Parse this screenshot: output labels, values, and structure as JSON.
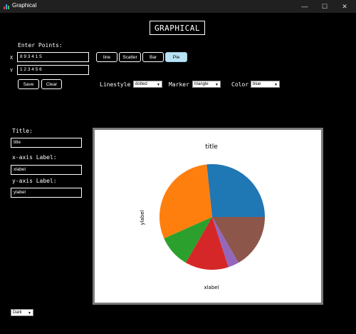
{
  "window": {
    "title": "Graphical",
    "minimize": "—",
    "maximize": "☐",
    "close": "✕"
  },
  "banner": "GRAPHICAL",
  "points": {
    "heading": "Enter Points:",
    "x_label": "X",
    "x_value": "8 9 3 4 1 5",
    "y_label": "Y",
    "y_value": "1 2 3 4 5 6"
  },
  "plot_types": [
    {
      "label": "line",
      "active": false
    },
    {
      "label": "Scatter",
      "active": false
    },
    {
      "label": "Bar",
      "active": false
    },
    {
      "label": "Pie",
      "active": true
    }
  ],
  "actions": {
    "save": "Save",
    "clear": "Clear"
  },
  "options": {
    "linestyle_label": "Linestyle",
    "linestyle_value": "dotted",
    "marker_label": "Marker",
    "marker_value": "triangle",
    "color_label": "Color",
    "color_value": "blue"
  },
  "labels": {
    "title_heading": "Title:",
    "title_value": "title",
    "xaxis_heading": "x-axis Label:",
    "xaxis_value": "xlabel",
    "yaxis_heading": "y-axis Label:",
    "yaxis_value": "ylabel"
  },
  "theme": {
    "value": "Dark"
  },
  "chart_data": {
    "type": "pie",
    "title": "title",
    "xlabel": "xlabel",
    "ylabel": "ylabel",
    "values": [
      8,
      9,
      3,
      4,
      1,
      5
    ],
    "colors": [
      "#1f77b4",
      "#ff7f0e",
      "#2ca02c",
      "#d62728",
      "#9467bd",
      "#8c564b"
    ]
  }
}
